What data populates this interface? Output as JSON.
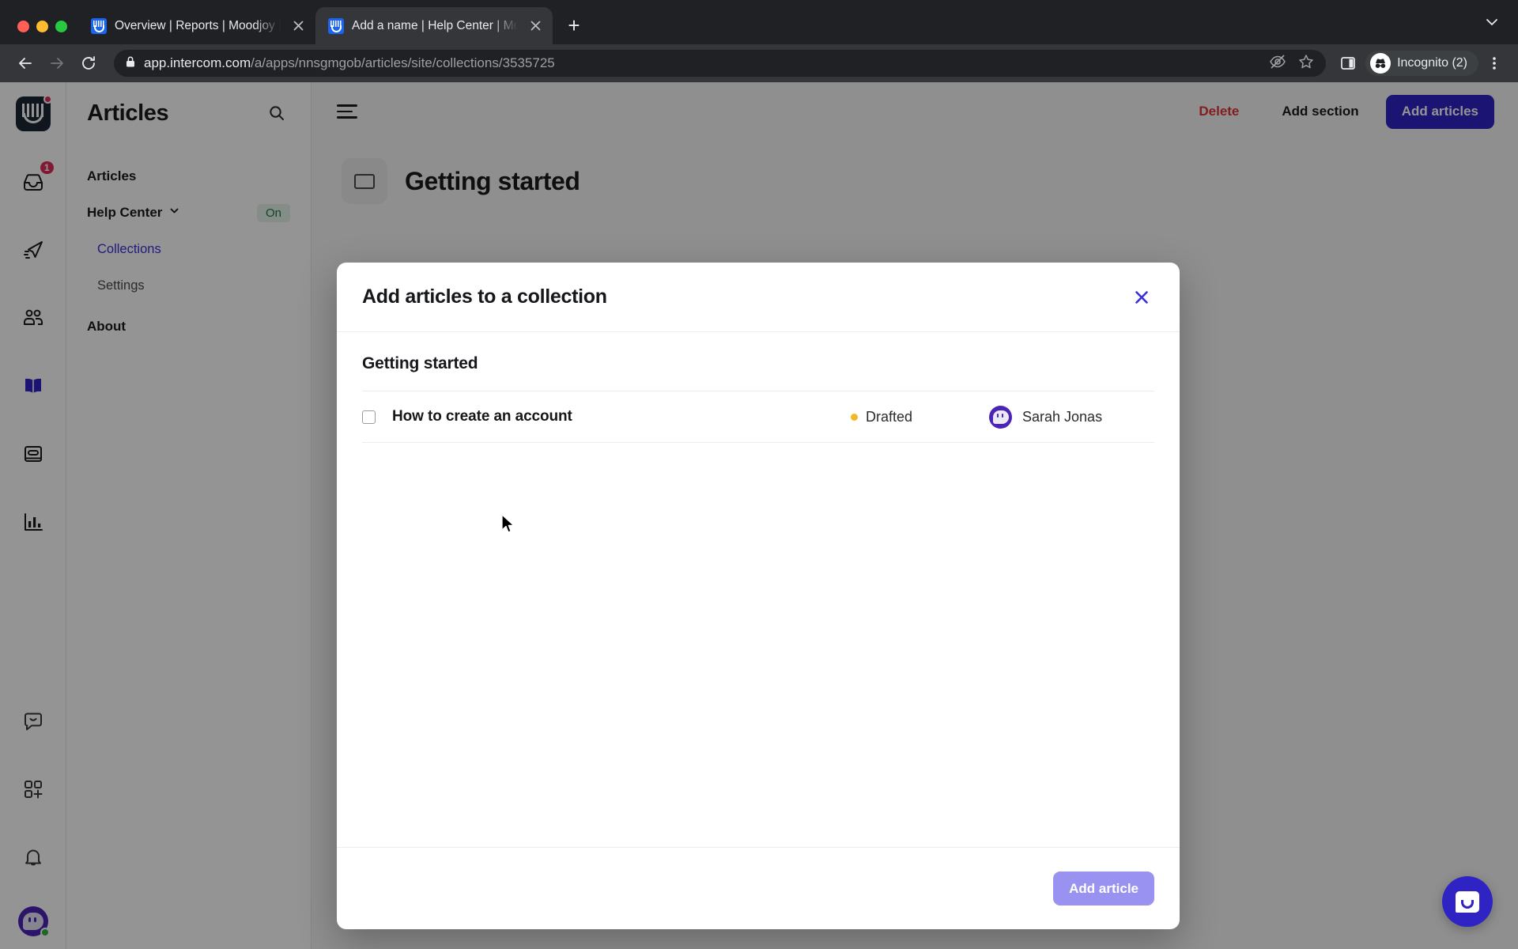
{
  "browser": {
    "tabs": [
      {
        "title": "Overview | Reports | Moodjoy |",
        "favicon": "intercom-favicon",
        "active": false
      },
      {
        "title": "Add a name | Help Center | Mo",
        "favicon": "intercom-favicon",
        "active": true
      }
    ],
    "new_tab_label": "+",
    "url_host": "app.intercom.com",
    "url_path": "/a/apps/nnsgmgob/articles/site/collections/3535725",
    "profile_label": "Incognito (2)",
    "icons": {
      "back": "back-arrow-icon",
      "forward": "forward-arrow-icon",
      "reload": "reload-icon",
      "lock": "lock-icon",
      "tracking_protection": "eye-slash-icon",
      "bookmark": "star-icon",
      "side_panel": "side-panel-icon",
      "incognito": "incognito-hat-icon",
      "menu": "kebab-menu-icon",
      "tab_search": "chevron-down-icon"
    }
  },
  "rail": {
    "items": [
      {
        "name": "intercom-logo",
        "badge": ""
      },
      {
        "name": "inbox-icon",
        "badge": "1"
      },
      {
        "name": "send-outbound-icon",
        "badge": ""
      },
      {
        "name": "contacts-icon",
        "badge": ""
      },
      {
        "name": "articles-book-icon",
        "badge": "",
        "active": true
      },
      {
        "name": "news-card-icon",
        "badge": ""
      },
      {
        "name": "reports-chart-icon",
        "badge": ""
      },
      {
        "name": "messenger-icon",
        "badge": ""
      },
      {
        "name": "apps-add-icon",
        "badge": ""
      },
      {
        "name": "notifications-bell-icon",
        "badge": ""
      }
    ]
  },
  "nav": {
    "title": "Articles",
    "search_icon": "search-icon",
    "items": [
      {
        "label": "Articles",
        "kind": "top"
      },
      {
        "label": "Help Center",
        "kind": "top",
        "expandable": true,
        "badge": "On"
      },
      {
        "label": "Collections",
        "kind": "sub",
        "active": true
      },
      {
        "label": "Settings",
        "kind": "sub",
        "active": false
      },
      {
        "label": "About",
        "kind": "top"
      }
    ]
  },
  "main": {
    "menu_icon": "hamburger-icon",
    "actions": {
      "delete": "Delete",
      "add_section": "Add section",
      "add_articles": "Add articles"
    },
    "collection_title": "Getting started",
    "collection_icon": "collection-folder-icon"
  },
  "modal": {
    "title": "Add articles to a collection",
    "close_icon": "close-x-icon",
    "section_title": "Getting started",
    "articles": [
      {
        "title": "How to create an account",
        "checked": false,
        "status": "Drafted",
        "status_color": "#f2b824",
        "author": "Sarah Jonas",
        "avatar": "sarah-jonas-avatar"
      }
    ],
    "footer_button": "Add article",
    "footer_button_enabled": false
  },
  "launcher": {
    "icon": "intercom-messenger-launcher"
  },
  "colors": {
    "brand_primary": "#2f23c4",
    "link_active": "#3b2fd6",
    "danger": "#e03434",
    "status_drafted": "#f2b824",
    "badge_on_bg": "#e4f3e8",
    "badge_on_text": "#1f7a3d",
    "disabled_button": "#9a92f0"
  }
}
